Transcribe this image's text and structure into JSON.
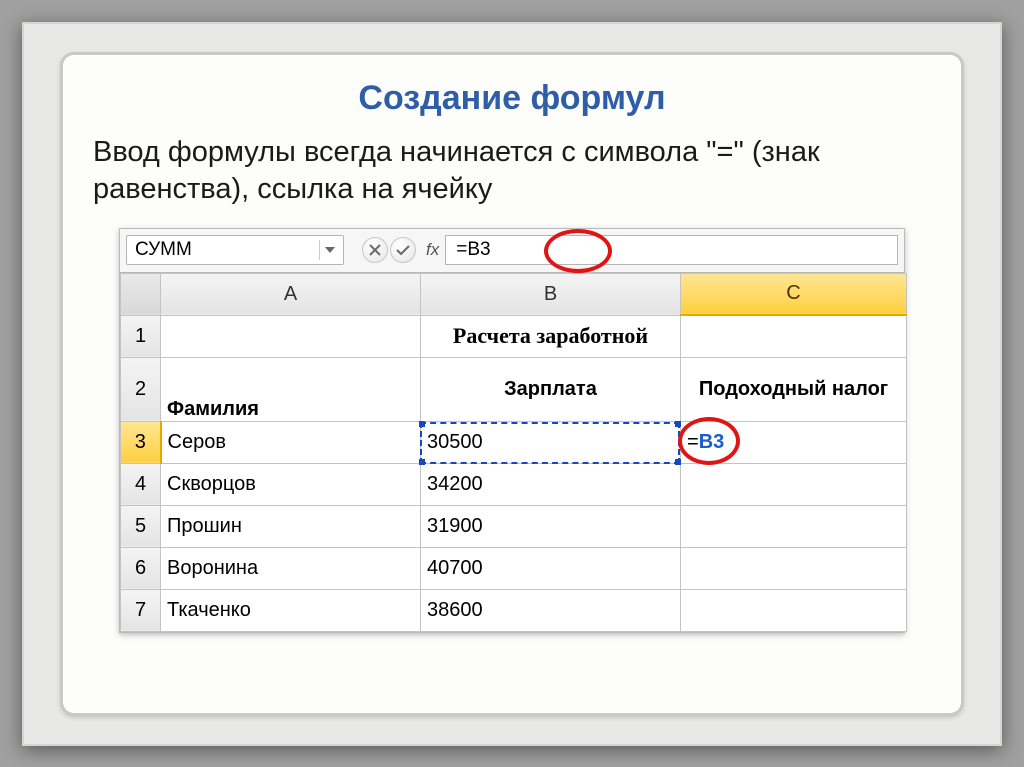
{
  "slide": {
    "title": "Создание формул",
    "body": "Ввод формулы всегда начинается с символа \"=\" (знак равенства), ссылка на ячейку"
  },
  "formula_bar": {
    "name_box": "СУММ",
    "fx_label": "fx",
    "formula": "=B3"
  },
  "columns": {
    "A": "A",
    "B": "B",
    "C": "C"
  },
  "rows": {
    "1": {
      "title": "Расчета заработной"
    },
    "2": {
      "A": "Фамилия",
      "B": "Зарплата",
      "C": "Подоходный налог"
    },
    "3": {
      "A": "Серов",
      "B": "30500",
      "C_eq": "=",
      "C_ref": "B3"
    },
    "4": {
      "A": "Скворцов",
      "B": "34200"
    },
    "5": {
      "A": "Прошин",
      "B": "31900"
    },
    "6": {
      "A": "Воронина",
      "B": "40700"
    },
    "7": {
      "A": "Ткаченко",
      "B": "38600"
    }
  },
  "row_labels": {
    "1": "1",
    "2": "2",
    "3": "3",
    "4": "4",
    "5": "5",
    "6": "6",
    "7": "7"
  }
}
